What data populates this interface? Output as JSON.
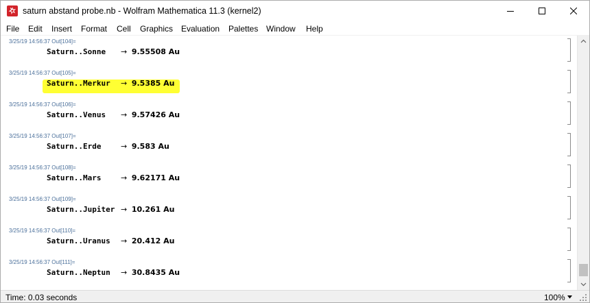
{
  "window": {
    "title": "saturn abstand probe.nb - Wolfram Mathematica 11.3 (kernel2)"
  },
  "menu": [
    "File",
    "Edit",
    "Insert",
    "Format",
    "Cell",
    "Graphics",
    "Evaluation",
    "Palettes",
    "Window",
    "Help"
  ],
  "cells": [
    {
      "label": "3/25/19 14:56:37 Out[104]=",
      "name": "Saturn..Sonne",
      "arrow": "→",
      "value": "9.55508 Au"
    },
    {
      "label": "3/25/19 14:56:37 Out[105]=",
      "name": "Saturn..Merkur",
      "arrow": "→",
      "value": "9.5385 Au"
    },
    {
      "label": "3/25/19 14:56:37 Out[106]=",
      "name": "Saturn..Venus",
      "arrow": "→",
      "value": "9.57426 Au"
    },
    {
      "label": "3/25/19 14:56:37 Out[107]=",
      "name": "Saturn..Erde",
      "arrow": "→",
      "value": "9.583 Au"
    },
    {
      "label": "3/25/19 14:56:37 Out[108]=",
      "name": "Saturn..Mars",
      "arrow": "→",
      "value": "9.62171 Au"
    },
    {
      "label": "3/25/19 14:56:37 Out[109]=",
      "name": "Saturn..Jupiter",
      "arrow": "→",
      "value": "10.261 Au"
    },
    {
      "label": "3/25/19 14:56:37 Out[110]=",
      "name": "Saturn..Uranus",
      "arrow": "→",
      "value": "20.412 Au"
    },
    {
      "label": "3/25/19 14:56:37 Out[111]=",
      "name": "Saturn..Neptun",
      "arrow": "→",
      "value": "30.8435 Au"
    }
  ],
  "status": {
    "time": "Time: 0.03 seconds",
    "zoom": "100%"
  },
  "colors": {
    "highlight": "#ffff33",
    "cell_label": "#4a6f9a",
    "app_icon": "#d2232a"
  },
  "icons": {
    "app": "mathematica-spikey-icon",
    "minimize": "minimize-icon",
    "maximize": "maximize-icon",
    "close": "close-icon"
  }
}
